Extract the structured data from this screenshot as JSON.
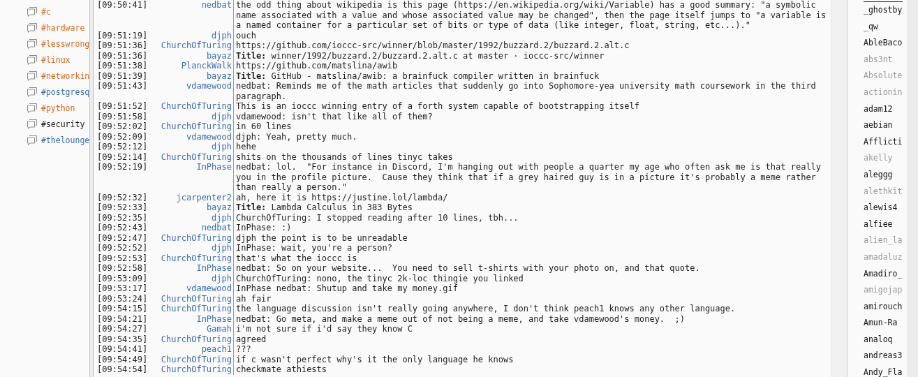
{
  "channels": [
    {
      "name": "#c",
      "color": "#d9681c"
    },
    {
      "name": "#hardware",
      "color": "#d9681c"
    },
    {
      "name": "#lesswrong",
      "color": "#d9681c"
    },
    {
      "name": "#linux",
      "color": "#d9681c"
    },
    {
      "name": "#networkin",
      "color": "#d9681c"
    },
    {
      "name": "#postgresq",
      "color": "#3b6cb4"
    },
    {
      "name": "#python",
      "color": "#d9681c"
    },
    {
      "name": "#security",
      "color": "#1a1a1a"
    },
    {
      "name": "#thelounge",
      "color": "#3b6cb4"
    }
  ],
  "messages": [
    {
      "time": "[09:50:41]",
      "nick": "nedbat",
      "text": "the odd thing about wikipedia is this page (https://en.wikipedia.org/wiki/Variable) has a good summary: \"a symbolic name associated with a value and whose associated value may be changed\", then the page itself jumps to \"a variable is a named container for a particular set of bits or type of data (like integer, float, string, etc...).\""
    },
    {
      "time": "[09:51:19]",
      "nick": "djph",
      "text": "ouch"
    },
    {
      "time": "[09:51:36]",
      "nick": "ChurchOfTuring",
      "text": "https://github.com/ioccc-src/winner/blob/master/1992/buzzard.2/buzzard.2.alt.c"
    },
    {
      "time": "[09:51:36]",
      "nick": "bayaz",
      "text": "**Title:** winner/1992/buzzard.2/buzzard.2.alt.c at master · ioccc-src/winner"
    },
    {
      "time": "[09:51:38]",
      "nick": "PlanckWalk",
      "text": "https://github.com/matslina/awib"
    },
    {
      "time": "[09:51:39]",
      "nick": "bayaz",
      "text": "**Title:** GitHub - matslina/awib: a brainfuck compiler written in brainfuck"
    },
    {
      "time": "[09:51:43]",
      "nick": "vdamewood",
      "text": "nedbat: Reminds me of the math articles that suddenly go into Sophomore-yea university math coursework in the third paragraph."
    },
    {
      "time": "[09:51:52]",
      "nick": "ChurchOfTuring",
      "text": "This is an ioccc winning entry of a forth system capable of bootstrapping itself"
    },
    {
      "time": "[09:51:58]",
      "nick": "djph",
      "text": "vdamewood: isn't that like all of them?"
    },
    {
      "time": "[09:52:02]",
      "nick": "ChurchOfTuring",
      "text": "in 60 lines"
    },
    {
      "time": "[09:52:09]",
      "nick": "vdamewood",
      "text": "djph: Yeah, pretty much."
    },
    {
      "time": "[09:52:12]",
      "nick": "djph",
      "text": "hehe"
    },
    {
      "time": "[09:52:14]",
      "nick": "ChurchOfTuring",
      "text": "shits on the thousands of lines tinyc takes"
    },
    {
      "time": "[09:52:19]",
      "nick": "InPhase",
      "text": "nedbat: lol.  \"For instance in Discord, I'm hanging out with people a quarter my age who often ask me is that really you in the profile picture.  Cause they think that if a grey haired guy is in a picture it's probably a meme rather than really a person.\""
    },
    {
      "time": "[09:52:32]",
      "nick": "jcarpenter2",
      "text": "ah, here it is https://justine.lol/lambda/"
    },
    {
      "time": "[09:52:33]",
      "nick": "bayaz",
      "text": "**Title:** Lambda Calculus in 383 Bytes"
    },
    {
      "time": "[09:52:35]",
      "nick": "djph",
      "text": "ChurchOfTuring: I stopped reading after 10 lines, tbh..."
    },
    {
      "time": "[09:52:43]",
      "nick": "nedbat",
      "text": "InPhase: :)"
    },
    {
      "time": "[09:52:47]",
      "nick": "ChurchOfTuring",
      "text": "djph the point is to be unreadable"
    },
    {
      "time": "[09:52:52]",
      "nick": "djph",
      "text": "InPhase: wait, you're a person?"
    },
    {
      "time": "[09:52:53]",
      "nick": "ChurchOfTuring",
      "text": "that's what the ioccc is"
    },
    {
      "time": "[09:52:58]",
      "nick": "InPhase",
      "text": "nedbat: So on your website...  You need to sell t-shirts with your photo on, and that quote."
    },
    {
      "time": "[09:53:09]",
      "nick": "djph",
      "text": "ChurchOfTuring: nono, the tinyc 2k-loc thingie you linked"
    },
    {
      "time": "[09:53:17]",
      "nick": "vdamewood",
      "text": "InPhase nedbat: Shutup and take my money.gif"
    },
    {
      "time": "[09:53:24]",
      "nick": "ChurchOfTuring",
      "text": "ah fair"
    },
    {
      "time": "[09:54:15]",
      "nick": "ChurchOfTuring",
      "text": "the language discussion isn't really going anywhere, I don't think peach1 knows any other language."
    },
    {
      "time": "[09:54:21]",
      "nick": "InPhase",
      "text": "nedbat: Go meta, and make a meme out of not being a meme, and take vdamewood's money.  ;)"
    },
    {
      "time": "[09:54:27]",
      "nick": "Gamah",
      "text": "i'm not sure if i'd say they know C"
    },
    {
      "time": "[09:54:35]",
      "nick": "ChurchOfTuring",
      "text": "agreed"
    },
    {
      "time": "[09:54:41]",
      "nick": "peach1",
      "text": "???"
    },
    {
      "time": "[09:54:49]",
      "nick": "ChurchOfTuring",
      "text": "if c wasn't perfect why's it the only language he knows"
    },
    {
      "time": "[09:54:54]",
      "nick": "ChurchOfTuring",
      "text": "checkmate athiests"
    }
  ],
  "users": [
    {
      "name": "_ghostby",
      "away": false
    },
    {
      "name": "_qw",
      "away": false
    },
    {
      "name": "AbleBaco",
      "away": false
    },
    {
      "name": "abs3nt",
      "away": true
    },
    {
      "name": "Absolute",
      "away": true
    },
    {
      "name": "actionin",
      "away": true
    },
    {
      "name": "adam12",
      "away": false
    },
    {
      "name": "aebian",
      "away": false
    },
    {
      "name": "Afflicti",
      "away": false
    },
    {
      "name": "akelly",
      "away": true
    },
    {
      "name": "aleggg",
      "away": false
    },
    {
      "name": "alethkit",
      "away": true
    },
    {
      "name": "alewis4",
      "away": false
    },
    {
      "name": "alfiee",
      "away": false
    },
    {
      "name": "alien_la",
      "away": true
    },
    {
      "name": "amadaluz",
      "away": true
    },
    {
      "name": "Amadiro_",
      "away": false
    },
    {
      "name": "amigojap",
      "away": true
    },
    {
      "name": "amirouch",
      "away": false
    },
    {
      "name": "Amun-Ra",
      "away": false
    },
    {
      "name": "analoq",
      "away": false
    },
    {
      "name": "andreas3",
      "away": false
    },
    {
      "name": "Andy_Fla",
      "away": false
    }
  ]
}
